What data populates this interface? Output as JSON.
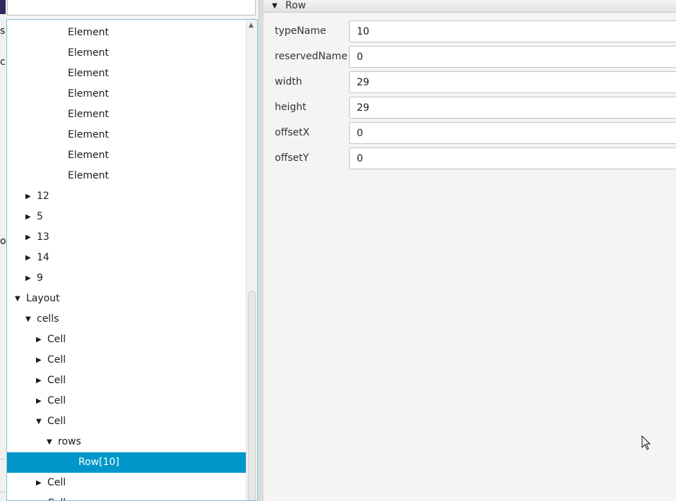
{
  "left_strip": {
    "glyphs": [
      "s",
      "c",
      "o"
    ]
  },
  "tree": {
    "rows": [
      {
        "label": "Element",
        "expanded": null
      },
      {
        "label": "Element",
        "expanded": null
      },
      {
        "label": "Element",
        "expanded": null
      },
      {
        "label": "Element",
        "expanded": null
      },
      {
        "label": "Element",
        "expanded": null
      },
      {
        "label": "Element",
        "expanded": null
      },
      {
        "label": "Element",
        "expanded": null
      },
      {
        "label": "Element",
        "expanded": null
      },
      {
        "label": "12",
        "expanded": false
      },
      {
        "label": "5",
        "expanded": false
      },
      {
        "label": "13",
        "expanded": false
      },
      {
        "label": "14",
        "expanded": false
      },
      {
        "label": "9",
        "expanded": false
      },
      {
        "label": "Layout",
        "expanded": true
      },
      {
        "label": "cells",
        "expanded": true
      },
      {
        "label": "Cell",
        "expanded": false
      },
      {
        "label": "Cell",
        "expanded": false
      },
      {
        "label": "Cell",
        "expanded": false
      },
      {
        "label": "Cell",
        "expanded": false
      },
      {
        "label": "Cell",
        "expanded": true
      },
      {
        "label": "rows",
        "expanded": true
      },
      {
        "label": "Row[10]",
        "expanded": null,
        "selected": true
      },
      {
        "label": "Cell",
        "expanded": false
      },
      {
        "label": "Cell",
        "expanded": false
      }
    ],
    "selection_color": "#0096c9"
  },
  "properties": {
    "section_title": "Row",
    "fields": [
      {
        "label": "typeName",
        "value": "10"
      },
      {
        "label": "reservedName",
        "value": "0"
      },
      {
        "label": "width",
        "value": "29"
      },
      {
        "label": "height",
        "value": "29"
      },
      {
        "label": "offsetX",
        "value": "0"
      },
      {
        "label": "offsetY",
        "value": "0"
      }
    ]
  },
  "icons": {
    "expanded_arrow": "triangle-down-icon",
    "collapsed_arrow": "triangle-right-icon",
    "scroll_up": "chevron-up-icon",
    "cursor": "mouse-pointer-icon"
  }
}
